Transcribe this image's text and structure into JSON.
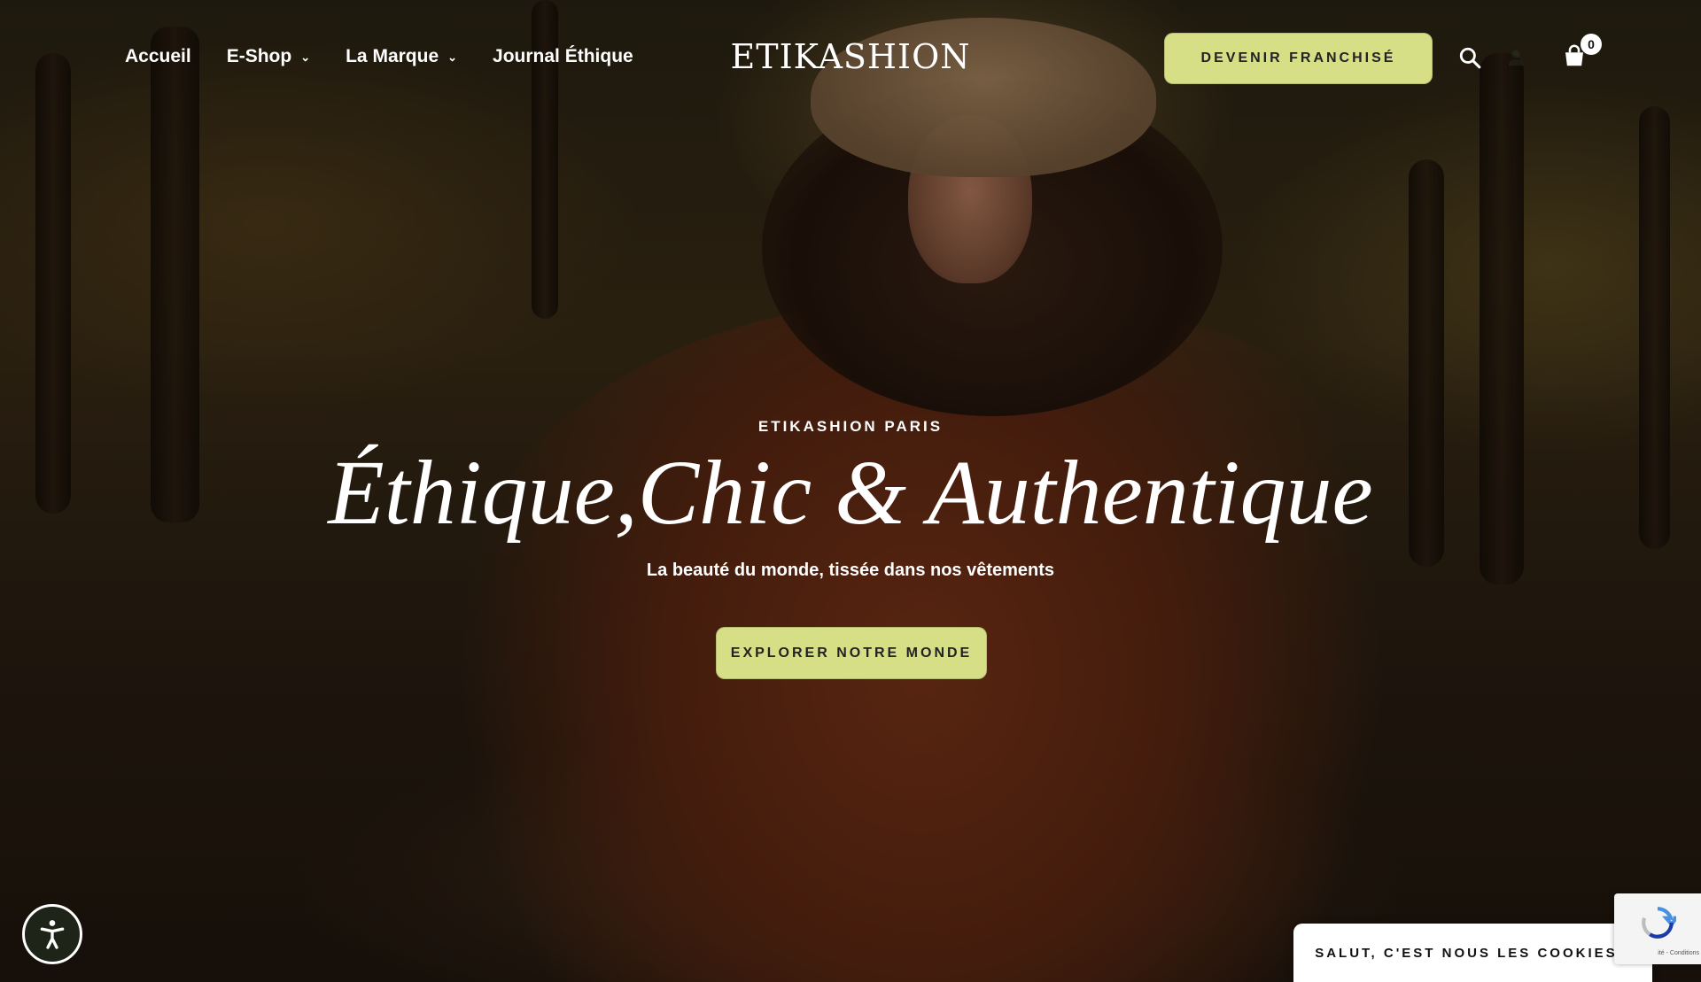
{
  "header": {
    "nav": [
      {
        "label": "Accueil",
        "has_dropdown": false
      },
      {
        "label": "E-Shop",
        "has_dropdown": true
      },
      {
        "label": "La Marque",
        "has_dropdown": true
      },
      {
        "label": "Journal Éthique",
        "has_dropdown": false
      }
    ],
    "logo": "ETIKASHION",
    "cta_label": "DEVENIR FRANCHISÉ",
    "cart_count": "0",
    "icons": [
      "search-icon",
      "user-icon",
      "cart-icon"
    ]
  },
  "hero": {
    "eyebrow": "ETIKASHION PARIS",
    "headline": "Éthique,Chic & Authentique",
    "subline": "La beauté du monde, tissée dans nos vêtements",
    "cta_label": "EXPLORER NOTRE MONDE"
  },
  "cookie_banner": {
    "label": "SALUT, C'EST NOUS LES COOKIES !"
  },
  "recaptcha": {
    "text": "ité - Conditions"
  },
  "colors": {
    "accent": "#d7df86",
    "text": "#ffffff"
  }
}
